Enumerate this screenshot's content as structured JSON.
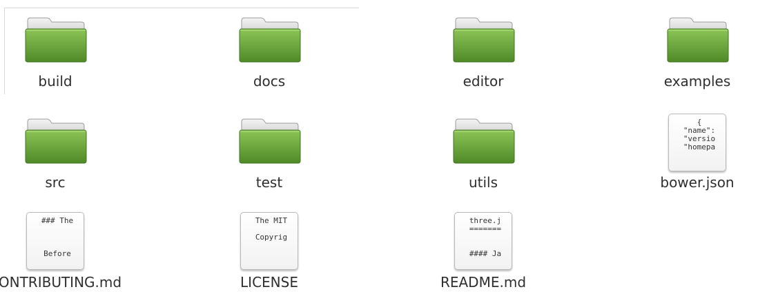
{
  "files": [
    {
      "name": "build",
      "kind": "folder"
    },
    {
      "name": "docs",
      "kind": "folder"
    },
    {
      "name": "editor",
      "kind": "folder"
    },
    {
      "name": "examples",
      "kind": "folder"
    },
    {
      "name": "src",
      "kind": "folder"
    },
    {
      "name": "test",
      "kind": "folder"
    },
    {
      "name": "utils",
      "kind": "folder"
    },
    {
      "name": "bower.json",
      "kind": "document",
      "preview": "{\n\"name\":\n\"versio\n\"homepa"
    },
    {
      "name": "CONTRIBUTING.md",
      "kind": "document",
      "preview": "### The\n\n\n\nBefore"
    },
    {
      "name": "LICENSE",
      "kind": "document",
      "preview": "The MIT\n\nCopyrig"
    },
    {
      "name": "README.md",
      "kind": "document",
      "preview": "three.j\n=======\n\n\n#### Ja"
    }
  ],
  "colors": {
    "folder_green": "#6aa63b",
    "folder_dark": "#4f8a28",
    "label_text": "#2e2e2e"
  }
}
